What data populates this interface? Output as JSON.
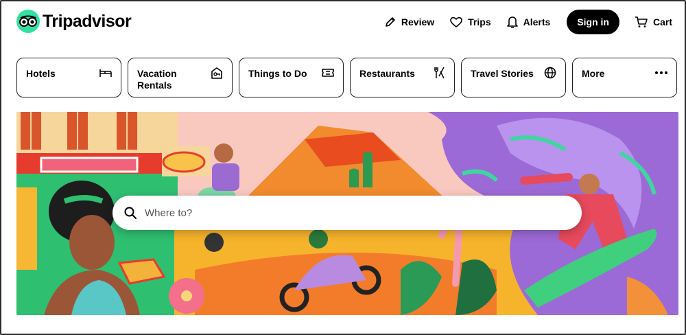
{
  "brand": {
    "name": "Tripadvisor",
    "accent": "#34e0a1"
  },
  "nav": {
    "review": "Review",
    "trips": "Trips",
    "alerts": "Alerts",
    "signin": "Sign in",
    "cart": "Cart"
  },
  "categories": [
    {
      "label": "Hotels",
      "icon": "bed-icon"
    },
    {
      "label": "Vacation Rentals",
      "icon": "house-key-icon"
    },
    {
      "label": "Things to Do",
      "icon": "ticket-icon"
    },
    {
      "label": "Restaurants",
      "icon": "fork-knife-icon"
    },
    {
      "label": "Travel Stories",
      "icon": "globe-icon"
    },
    {
      "label": "More",
      "icon": "more-dots-icon"
    }
  ],
  "search": {
    "placeholder": "Where to?"
  }
}
